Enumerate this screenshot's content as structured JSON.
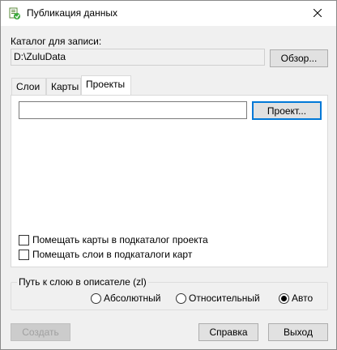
{
  "window": {
    "title": "Публикация данных",
    "icon": "green-data-publish-icon"
  },
  "catalog": {
    "label": "Каталог для записи:",
    "value": "D:\\ZuluData",
    "browse_label": "Обзор..."
  },
  "tabs": [
    {
      "label": "Слои",
      "active": false
    },
    {
      "label": "Карты",
      "active": false
    },
    {
      "label": "Проекты",
      "active": true
    }
  ],
  "projects_tab": {
    "project_path_value": "",
    "project_button_label": "Проект...",
    "checkbox_maps_label": "Помещать карты в подкаталог проекта",
    "checkbox_maps_checked": false,
    "checkbox_layers_label": "Помещать слои в подкаталоги карт",
    "checkbox_layers_checked": false
  },
  "layer_path": {
    "group_label": "Путь к слою в описателе (zl)",
    "options": [
      {
        "label": "Абсолютный",
        "checked": false
      },
      {
        "label": "Относительный",
        "checked": false
      },
      {
        "label": "Авто",
        "checked": true
      }
    ]
  },
  "footer": {
    "create_label": "Создать",
    "create_enabled": false,
    "help_label": "Справка",
    "exit_label": "Выход"
  },
  "colors": {
    "focus_border": "#0078d7",
    "dialog_bg": "#f0f0f0"
  }
}
